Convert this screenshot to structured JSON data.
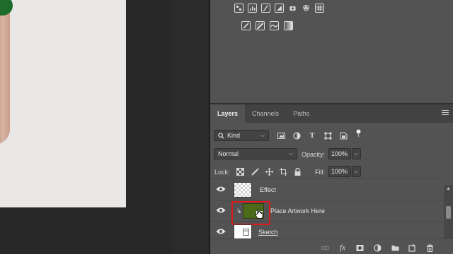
{
  "adjustments": {
    "row1": [
      "brightness-contrast-icon",
      "levels-icon",
      "curves-icon",
      "exposure-icon",
      "vibrance-icon",
      "hue-saturation-icon",
      "color-balance-icon"
    ],
    "row2": [
      "invert-icon",
      "posterize-icon",
      "threshold-icon",
      "gradient-map-icon"
    ]
  },
  "tabs": [
    {
      "label": "Layers",
      "active": true
    },
    {
      "label": "Channels",
      "active": false
    },
    {
      "label": "Paths",
      "active": false
    }
  ],
  "filter": {
    "kind_label": "Kind"
  },
  "blend": {
    "mode": "Normal",
    "opacity_label": "Opacity:",
    "opacity_value": "100%"
  },
  "lock": {
    "label": "Lock:",
    "fill_label": "Fill:",
    "fill_value": "100%"
  },
  "layers": [
    {
      "name": "Effect",
      "visible": true
    },
    {
      "name": "Place Artwork Here",
      "visible": true,
      "clipped": true,
      "smart_object": true,
      "highlighted": true
    },
    {
      "name": "Sketch",
      "visible": true
    }
  ],
  "colors": {
    "panel_bg": "#535353",
    "highlight_red": "#e0191b",
    "thumb_green": "#4b6b1a"
  }
}
